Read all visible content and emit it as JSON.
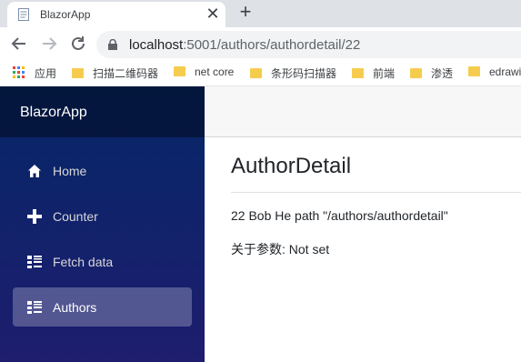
{
  "browser": {
    "tab_title": "BlazorApp",
    "url_host": "localhost",
    "url_rest": ":5001/authors/authordetail/22",
    "bookmarks": [
      {
        "label": "应用",
        "icon": "apps-grid-icon"
      },
      {
        "label": "扫描二维码器",
        "icon": "folder-icon"
      },
      {
        "label": "net core",
        "icon": "folder-icon"
      },
      {
        "label": "条形码扫描器",
        "icon": "folder-icon"
      },
      {
        "label": "前端",
        "icon": "folder-icon"
      },
      {
        "label": "渗透",
        "icon": "folder-icon"
      },
      {
        "label": "edrawi",
        "icon": "folder-icon"
      }
    ]
  },
  "sidebar": {
    "brand": "BlazorApp",
    "items": [
      {
        "label": "Home",
        "icon": "home-icon",
        "active": false
      },
      {
        "label": "Counter",
        "icon": "plus-icon",
        "active": false
      },
      {
        "label": "Fetch data",
        "icon": "list-icon",
        "active": false
      },
      {
        "label": "Authors",
        "icon": "list-icon",
        "active": true
      }
    ]
  },
  "main": {
    "title": "AuthorDetail",
    "detail_line": "22 Bob He path \"/authors/authordetail\"",
    "param_line": "关于参数: Not set"
  },
  "colors": {
    "sidebar_top": "#052767",
    "sidebar_bottom": "#1e1d6e",
    "folder": "#f6cc4e"
  }
}
